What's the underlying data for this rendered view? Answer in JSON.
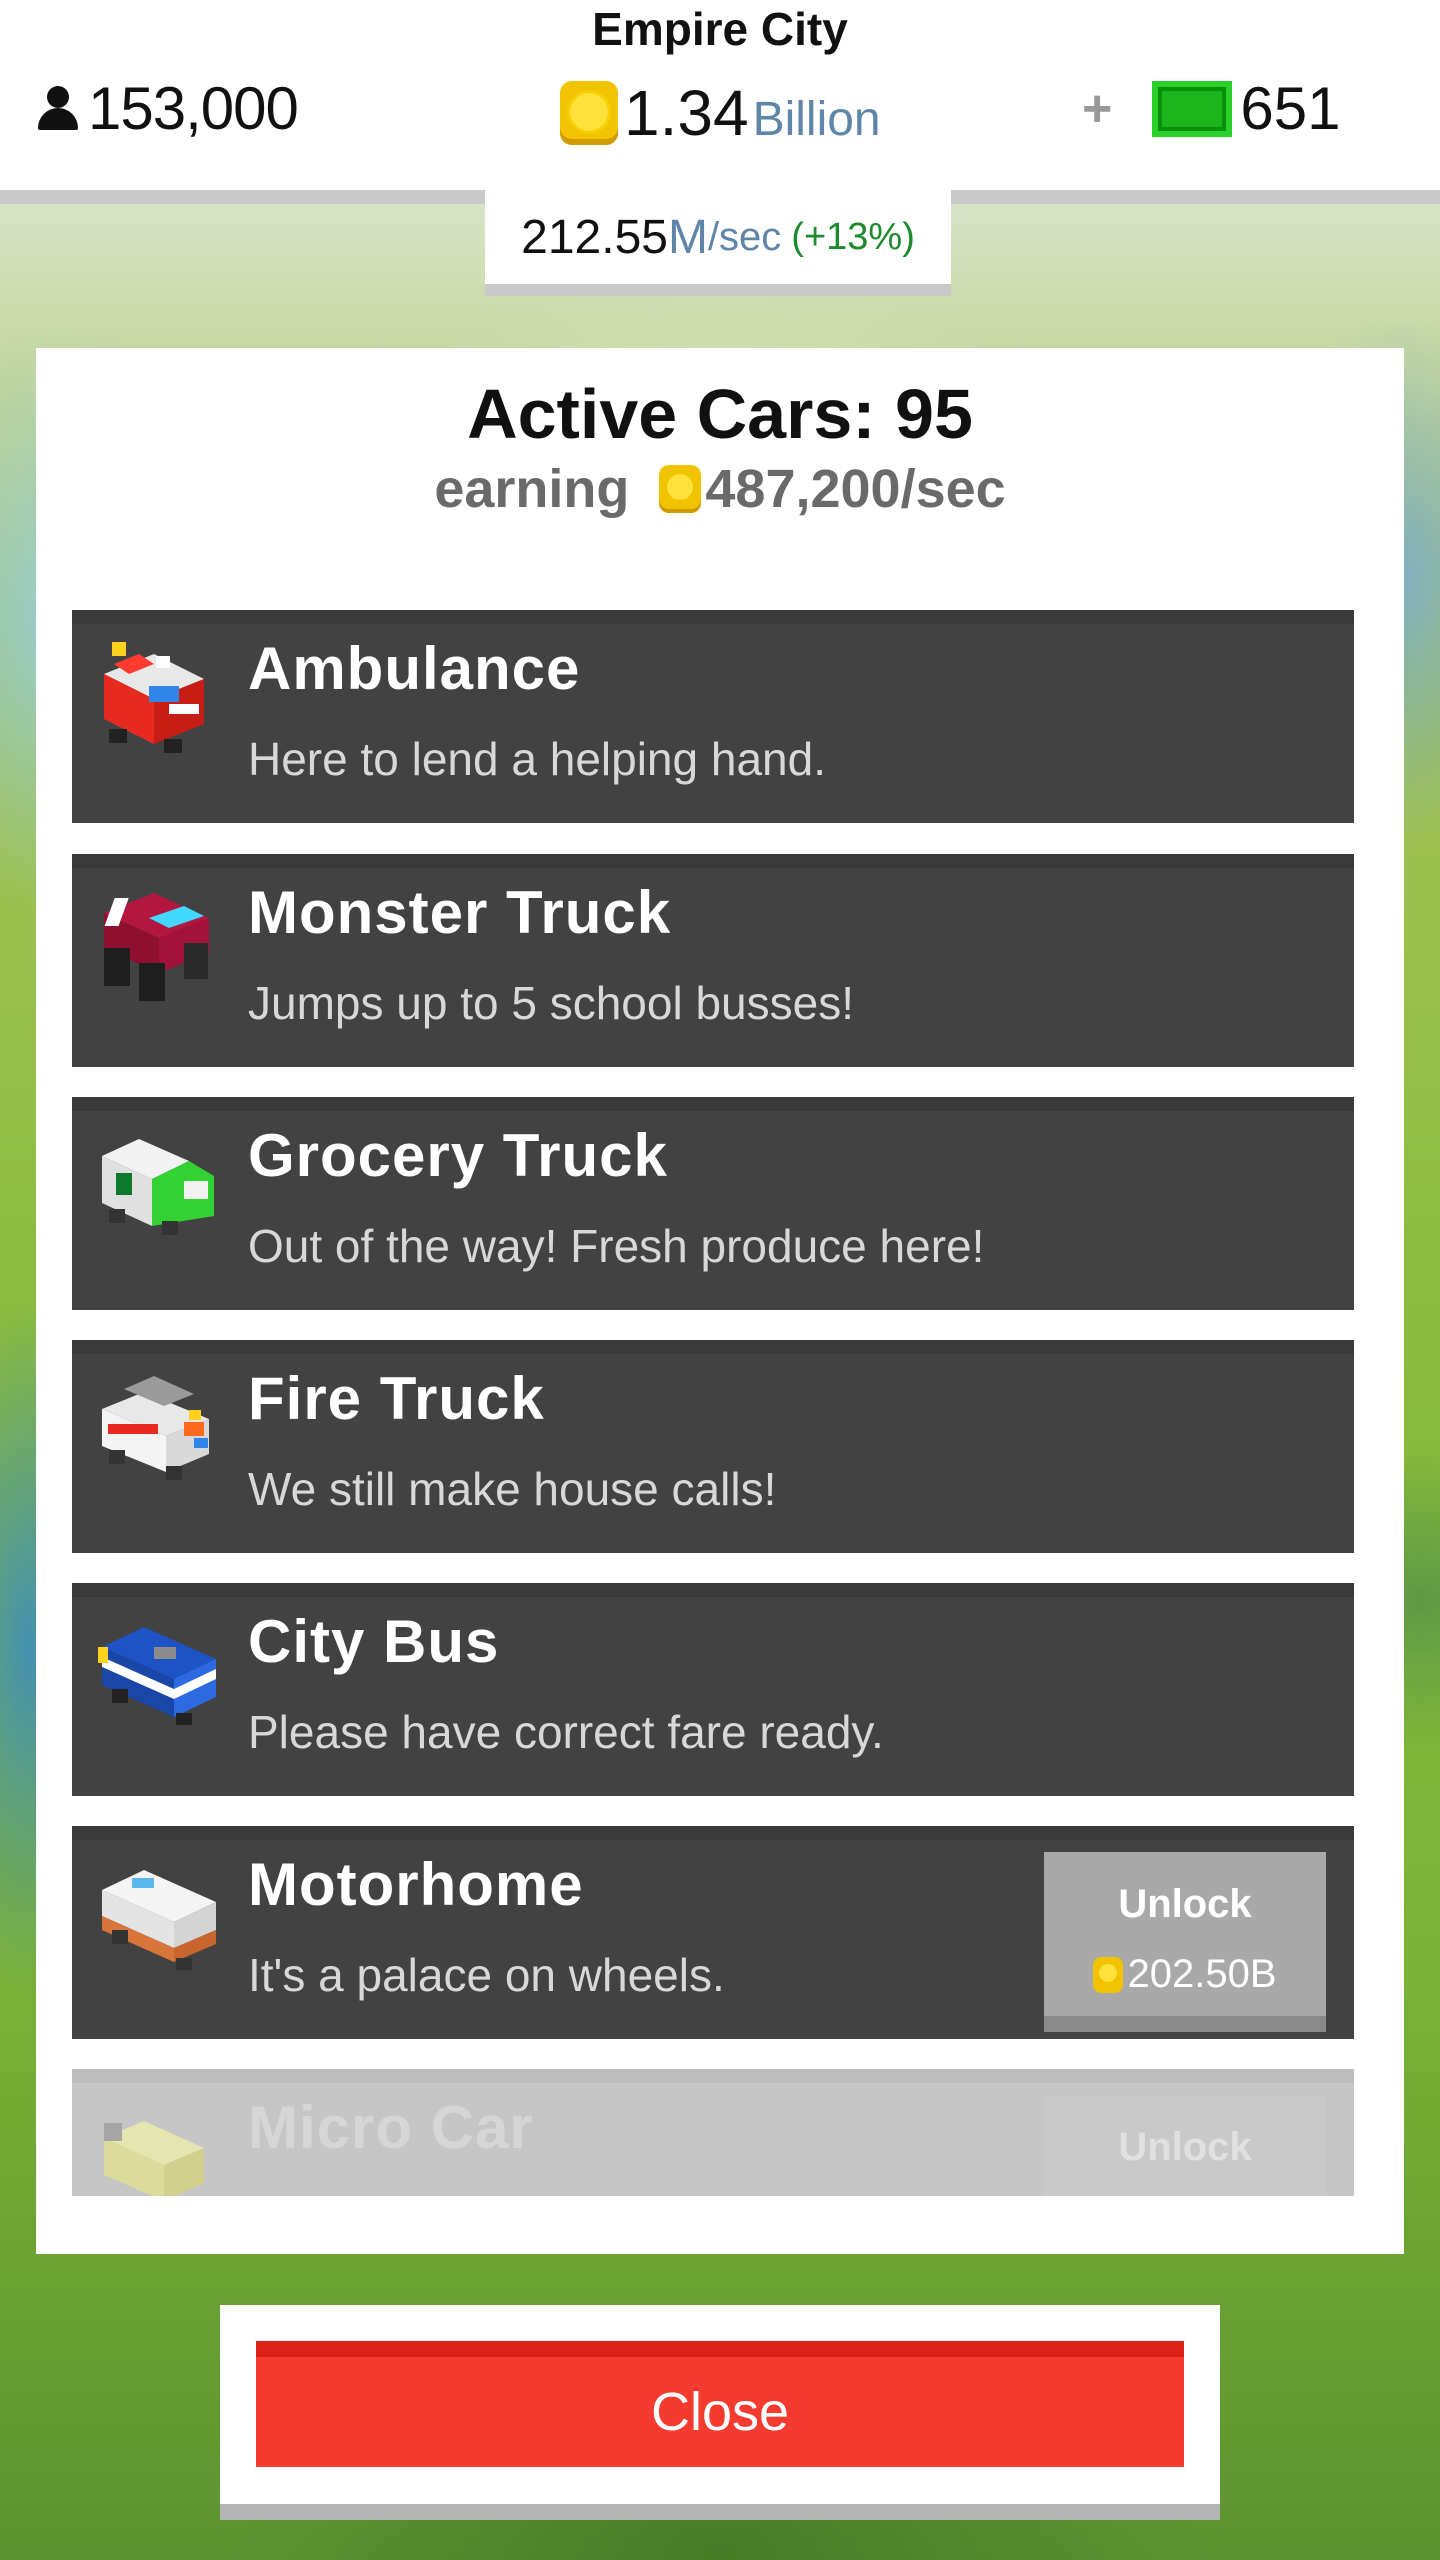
{
  "hud": {
    "city_name": "Empire City",
    "population": "153,000",
    "money_value": "1.34",
    "money_unit": "Billion",
    "plus": "+",
    "cash": "651",
    "rate_value": "212.55",
    "rate_unit": "M",
    "rate_per": "/sec",
    "rate_bonus": "(+13%)"
  },
  "panel": {
    "title": "Active Cars: 95",
    "earning_label": "earning",
    "earning_value": "487,200/sec"
  },
  "cars": [
    {
      "name": "Ambulance",
      "desc": "Here to lend a helping hand.",
      "icon": "ambulance-icon"
    },
    {
      "name": "Monster Truck",
      "desc": "Jumps up to 5 school busses!",
      "icon": "monster-truck-icon"
    },
    {
      "name": "Grocery Truck",
      "desc": "Out of the way! Fresh produce here!",
      "icon": "grocery-truck-icon"
    },
    {
      "name": "Fire Truck",
      "desc": "We still make house calls!",
      "icon": "fire-truck-icon"
    },
    {
      "name": "City Bus",
      "desc": "Please have correct fare ready.",
      "icon": "city-bus-icon"
    },
    {
      "name": "Motorhome",
      "desc": "It's a palace on wheels.",
      "icon": "motorhome-icon",
      "unlock_label": "Unlock",
      "unlock_price": "202.50B"
    },
    {
      "name": "Micro Car",
      "desc": "",
      "icon": "micro-car-icon",
      "unlock_label": "Unlock"
    }
  ],
  "close_label": "Close"
}
